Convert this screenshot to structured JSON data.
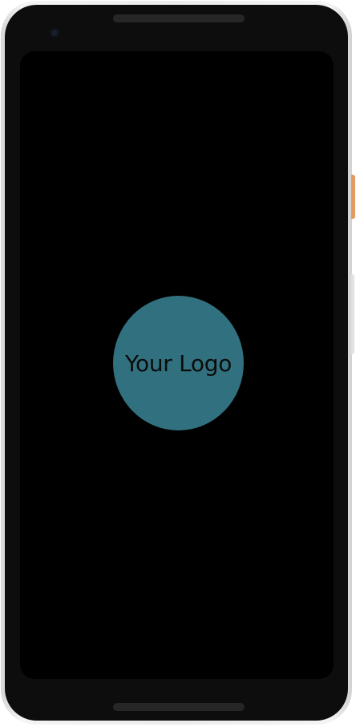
{
  "splash": {
    "logo_text": "Your Logo"
  },
  "colors": {
    "screen_background": "#000000",
    "logo_circle": "#31717f",
    "logo_text": "#0b0b0b",
    "device_frame": "#ececec",
    "power_button_accent": "#e39a5e"
  },
  "icons": {
    "front_camera": "front-camera-icon"
  }
}
